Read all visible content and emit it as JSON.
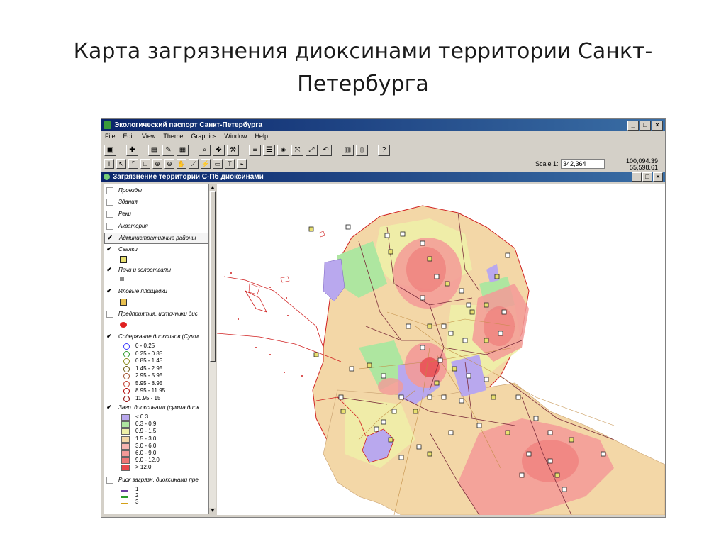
{
  "slide": {
    "title_line1": "Карта загрязнения диоксинами территории Санкт-",
    "title_line2": "Петербурга"
  },
  "window": {
    "title": "Экологический паспорт Санкт-Петербурга",
    "controls": [
      "_",
      "□",
      "×"
    ]
  },
  "menu": [
    "File",
    "Edit",
    "View",
    "Theme",
    "Graphics",
    "Window",
    "Help"
  ],
  "toolbar": {
    "scale_label": "Scale 1:",
    "scale_value": "342,364",
    "coord_x": "100,094.39",
    "coord_y": "55,598.61"
  },
  "document": {
    "title": "Загрязнение территории С-Пб  диоксинами"
  },
  "legend": {
    "layers": [
      {
        "label": "Проезды",
        "checked": false
      },
      {
        "label": "Здания",
        "checked": false
      },
      {
        "label": "Реки",
        "checked": false
      },
      {
        "label": "Акватория",
        "checked": false
      },
      {
        "label": "Административные районы",
        "checked": true
      },
      {
        "label": "Свалки",
        "checked": true
      },
      {
        "label": "Печи и золоотвалы",
        "checked": true
      },
      {
        "label": "Иловые площадки",
        "checked": true
      },
      {
        "label": "Предприятия, источники дис",
        "checked": false
      },
      {
        "label": "Содержание диоксинов (Сумм",
        "checked": true
      },
      {
        "label": "Загр. диоксинами (сумма диок",
        "checked": true
      },
      {
        "label": "Риск загрязн. диоксинами пре",
        "checked": false
      }
    ],
    "content_classes": [
      {
        "label": "0 - 0.25",
        "color": "#3b3bff"
      },
      {
        "label": "0.25 - 0.85",
        "color": "#2c9c2c"
      },
      {
        "label": "0.85 - 1.45",
        "color": "#8a8a1a"
      },
      {
        "label": "1.45 - 2.95",
        "color": "#6b5a10"
      },
      {
        "label": "2.95 - 5.95",
        "color": "#a0522d"
      },
      {
        "label": "5.95 - 8.95",
        "color": "#c0392b"
      },
      {
        "label": "8.95 - 11.95",
        "color": "#b00000"
      },
      {
        "label": "11.95 - 15",
        "color": "#8b0000"
      }
    ],
    "zone_classes": [
      {
        "label": "< 0.3",
        "color": "#b9a8ee"
      },
      {
        "label": "0.3 - 0.9",
        "color": "#aee6a0"
      },
      {
        "label": "0.9 - 1.5",
        "color": "#eef0a8"
      },
      {
        "label": "1.5 - 3.0",
        "color": "#f3d7a7"
      },
      {
        "label": "3.0 - 6.0",
        "color": "#f5b4b0"
      },
      {
        "label": "6.0 - 9.0",
        "color": "#f39a98"
      },
      {
        "label": "9.0 - 12.0",
        "color": "#ee7676"
      },
      {
        "label": "> 12.0",
        "color": "#e8474c"
      }
    ],
    "risk_classes": [
      {
        "label": "1",
        "color": "#6b3fa0"
      },
      {
        "label": "2",
        "color": "#2c9c2c"
      },
      {
        "label": "3",
        "color": "#d4a017"
      }
    ]
  },
  "map_colors": {
    "water": "#ffffff",
    "boundary": "#7a2b3a",
    "coast": "#d02020",
    "road": "#c08a40",
    "marker_fill": "#e8e070",
    "marker_border": "#222222"
  }
}
